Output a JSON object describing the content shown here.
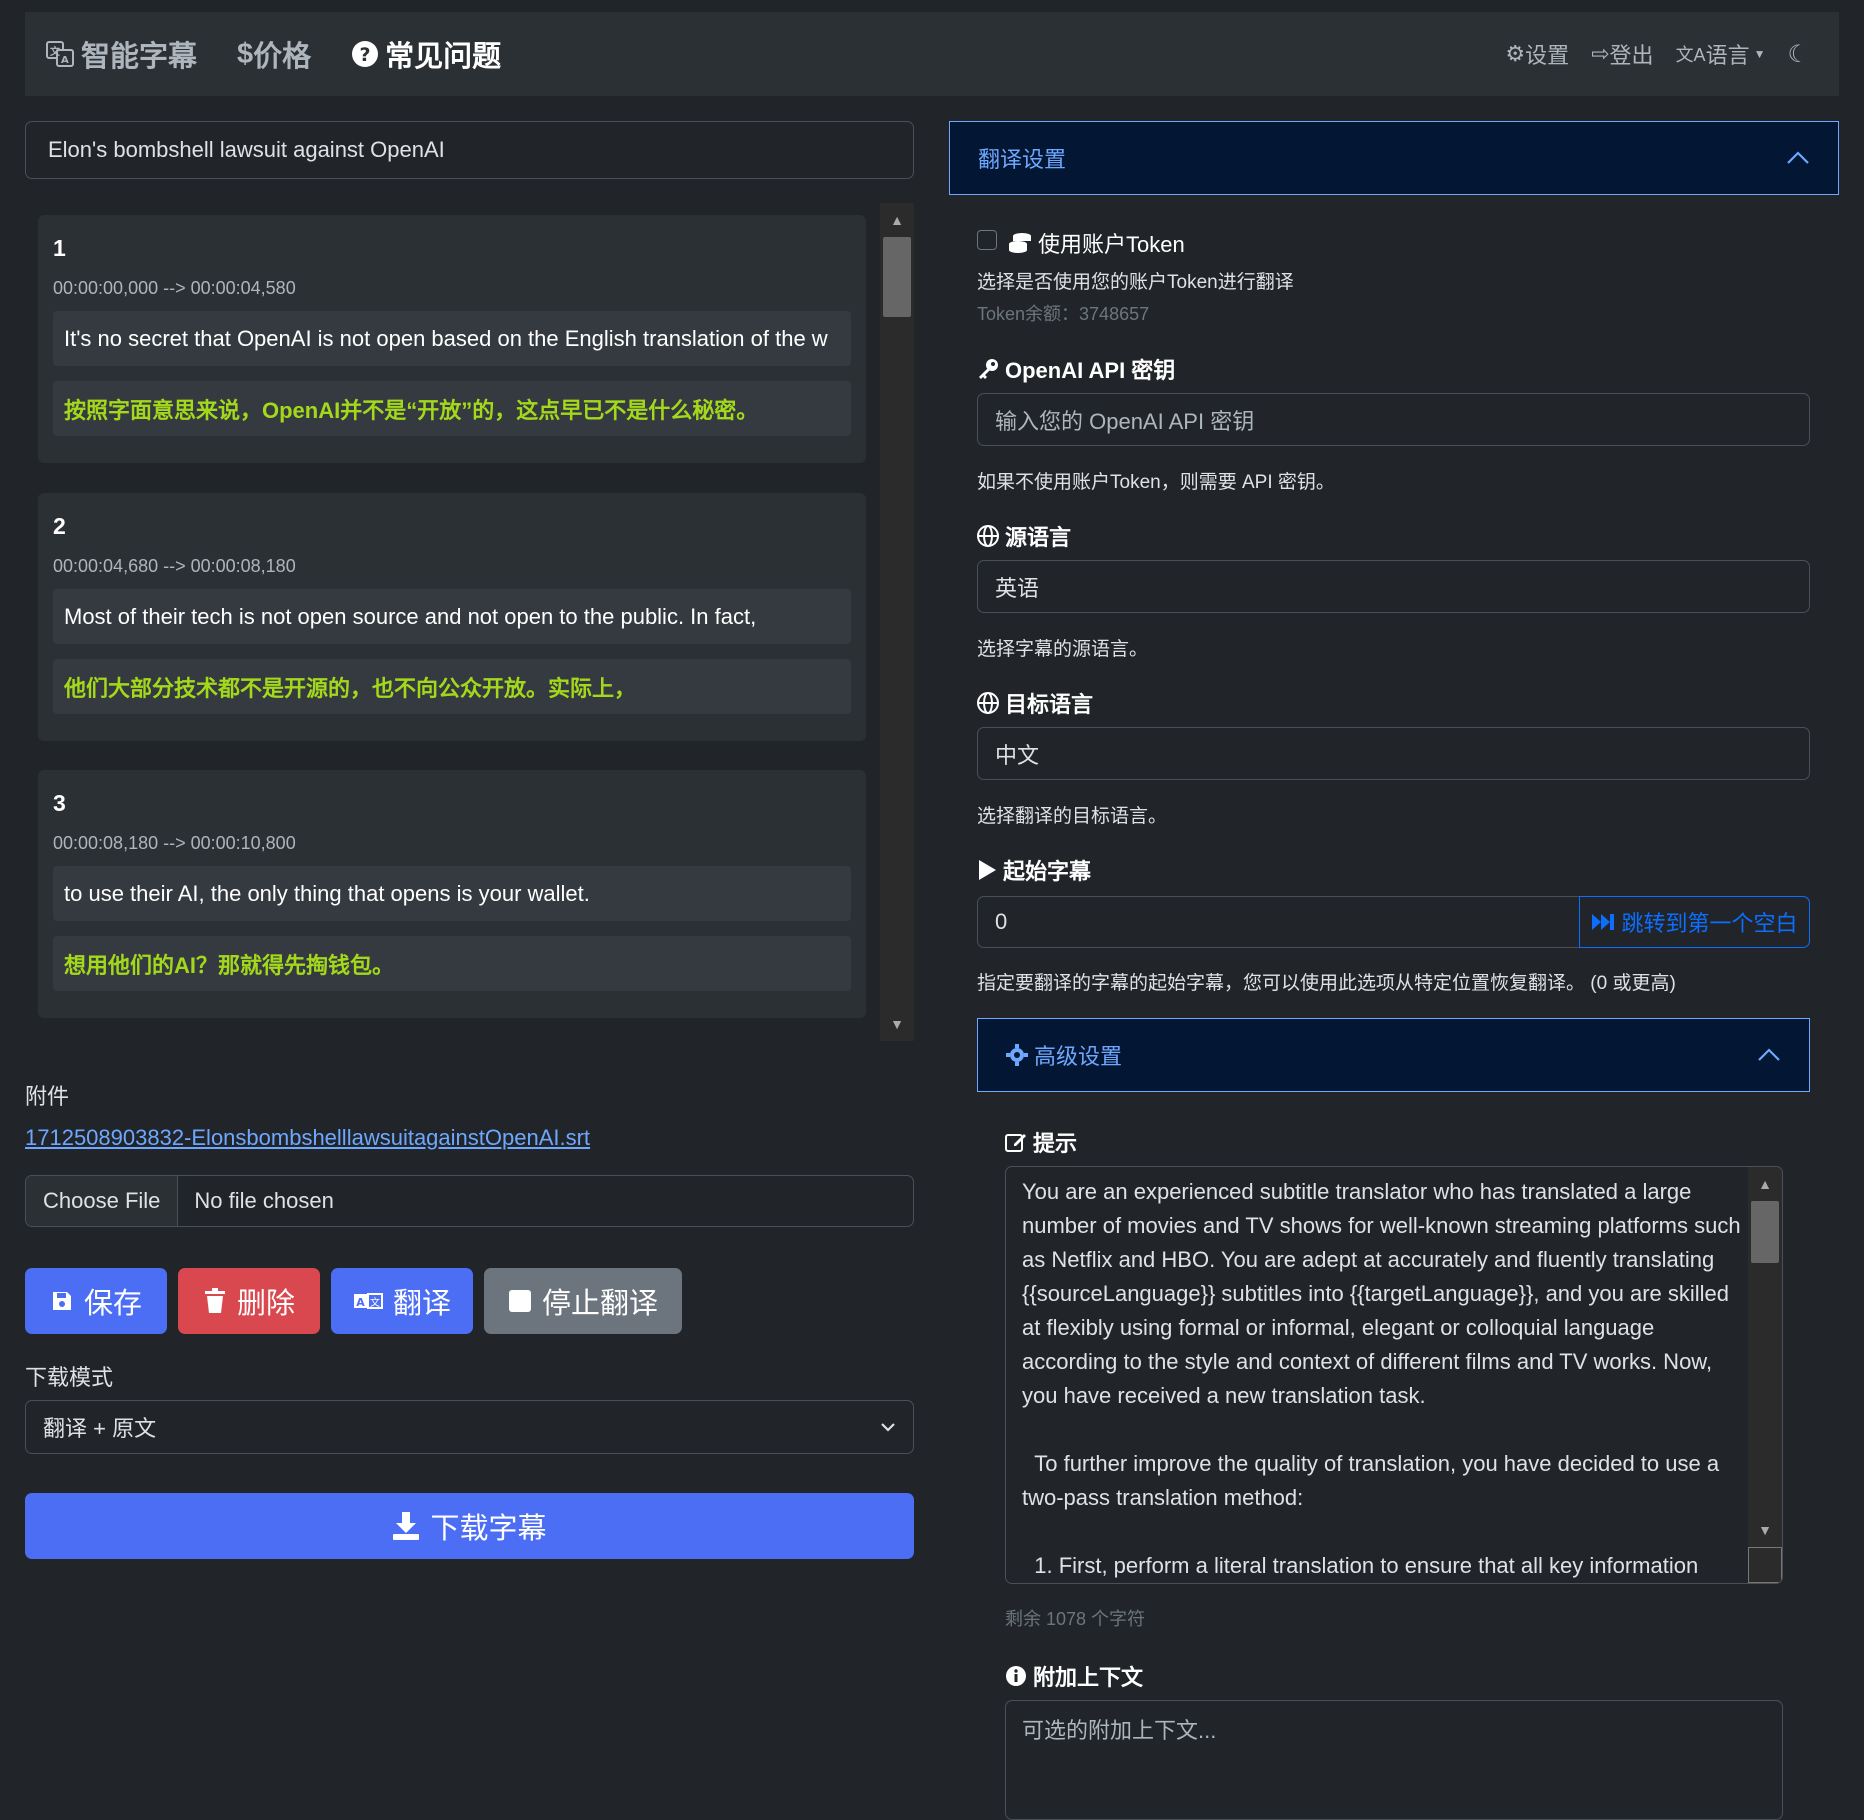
{
  "nav": {
    "brand": "智能字幕",
    "pricing": "价格",
    "faq": "常见问题",
    "settings": "设置",
    "logout": "登出",
    "language": "语言"
  },
  "editor": {
    "title": "Elon's bombshell lawsuit against OpenAI",
    "subtitles": [
      {
        "num": "1",
        "time": "00:00:00,000 --> 00:00:04,580",
        "original": "It's no secret that OpenAI is not open based on the English translation of the w",
        "translation": "按照字面意思来说，OpenAI并不是“开放”的，这点早已不是什么秘密。"
      },
      {
        "num": "2",
        "time": "00:00:04,680 --> 00:00:08,180",
        "original": "Most of their tech is not open source and not open to the public. In fact,",
        "translation": "他们大部分技术都不是开源的，也不向公众开放。实际上，"
      },
      {
        "num": "3",
        "time": "00:00:08,180 --> 00:00:10,800",
        "original": "to use their AI, the only thing that opens is your wallet.",
        "translation": "想用他们的AI？那就得先掏钱包。"
      }
    ],
    "attachment_label": "附件",
    "attachment_file": "1712508903832-ElonsbombshelllawsuitagainstOpenAI.srt",
    "choose_file": "Choose File",
    "no_file": "No file chosen",
    "buttons": {
      "save": "保存",
      "delete": "删除",
      "translate": "翻译",
      "stop": "停止翻译"
    },
    "download_mode_label": "下载模式",
    "download_mode_value": "翻译 + 原文",
    "download_button": "下载字幕"
  },
  "settings_panel": {
    "header": "翻译设置",
    "use_token_label": "使用账户Token",
    "use_token_help": "选择是否使用您的账户Token进行翻译",
    "token_balance": "Token余额：3748657",
    "api_key_label": "OpenAI API 密钥",
    "api_key_placeholder": "输入您的 OpenAI API 密钥",
    "api_key_help": "如果不使用账户Token，则需要 API 密钥。",
    "source_label": "源语言",
    "source_value": "英语",
    "source_help": "选择字幕的源语言。",
    "target_label": "目标语言",
    "target_value": "中文",
    "target_help": "选择翻译的目标语言。",
    "start_label": "起始字幕",
    "start_value": "0",
    "jump_button": "跳转到第一个空白",
    "start_help": "指定要翻译的字幕的起始字幕，您可以使用此选项从特定位置恢复翻译。 (0 或更高)",
    "advanced_header": "高级设置",
    "prompt_label": "提示",
    "prompt_text": "You are an experienced subtitle translator who has translated a large number of movies and TV shows for well-known streaming platforms such as Netflix and HBO. You are adept at accurately and fluently translating {{sourceLanguage}} subtitles into {{targetLanguage}}, and you are skilled at flexibly using formal or informal, elegant or colloquial language according to the style and context of different films and TV works. Now, you have received a new translation task.\n\n  To further improve the quality of translation, you have decided to use a two-pass translation method:\n\n  1. First, perform a literal translation to ensure that all key information",
    "remaining": "剩余 1078 个字符",
    "context_label": "附加上下文",
    "context_placeholder": "可选的附加上下文..."
  },
  "colors": {
    "background": "#212529",
    "primary": "#4c6ef5",
    "danger": "#d9484f",
    "secondary": "#6c757d",
    "translation_text": "#a3d81b",
    "link": "#6ea8fe"
  }
}
